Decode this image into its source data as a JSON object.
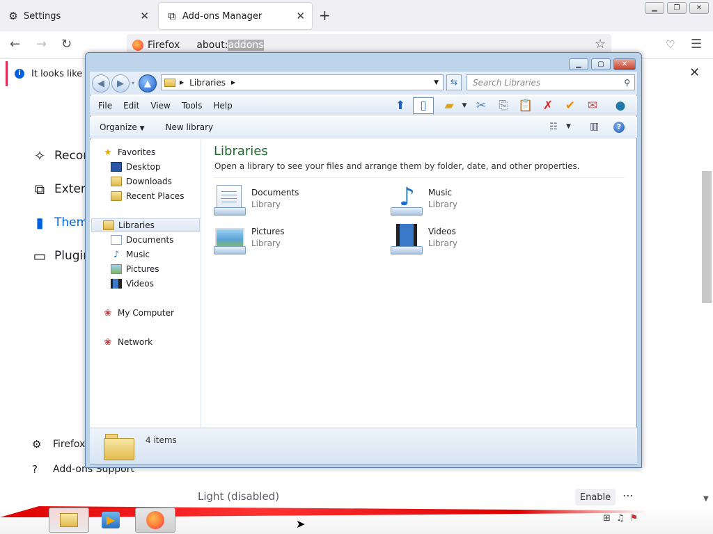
{
  "firefox": {
    "tabs": [
      {
        "label": "Settings",
        "icon": "gear-icon"
      },
      {
        "label": "Add-ons Manager",
        "icon": "puzzle-icon"
      }
    ],
    "url": {
      "identity": "Firefox",
      "prefix": "about:",
      "selected": "addons"
    },
    "notice": "It looks like you",
    "categories": [
      "Recom",
      "Extens",
      "Theme",
      "Plugin"
    ],
    "footer": {
      "settings": "Firefox",
      "support": "Add-ons Support"
    },
    "theme_row": {
      "name": "Light (disabled)",
      "enable": "Enable"
    },
    "colors": {
      "accent": "#0061e0",
      "notice_bar": "#e22850"
    }
  },
  "explorer": {
    "address": "Libraries",
    "search_placeholder": "Search Libraries",
    "menu": [
      "File",
      "Edit",
      "View",
      "Tools",
      "Help"
    ],
    "commands": {
      "organize": "Organize",
      "new_library": "New library"
    },
    "nav": {
      "favorites": "Favorites",
      "desktop": "Desktop",
      "downloads": "Downloads",
      "recent": "Recent Places",
      "libraries": "Libraries",
      "documents": "Documents",
      "music": "Music",
      "pictures": "Pictures",
      "videos": "Videos",
      "computer": "My Computer",
      "network": "Network"
    },
    "content": {
      "title": "Libraries",
      "description": "Open a library to see your files and arrange them by folder, date, and other properties.",
      "items": [
        {
          "name": "Documents",
          "type": "Library",
          "icon": "documents-library-icon"
        },
        {
          "name": "Music",
          "type": "Library",
          "icon": "music-library-icon"
        },
        {
          "name": "Pictures",
          "type": "Library",
          "icon": "pictures-library-icon"
        },
        {
          "name": "Videos",
          "type": "Library",
          "icon": "videos-library-icon"
        }
      ]
    },
    "status": "4 items",
    "colors": {
      "title": "#1e6a2e",
      "chrome": "#bcd3ea"
    }
  }
}
